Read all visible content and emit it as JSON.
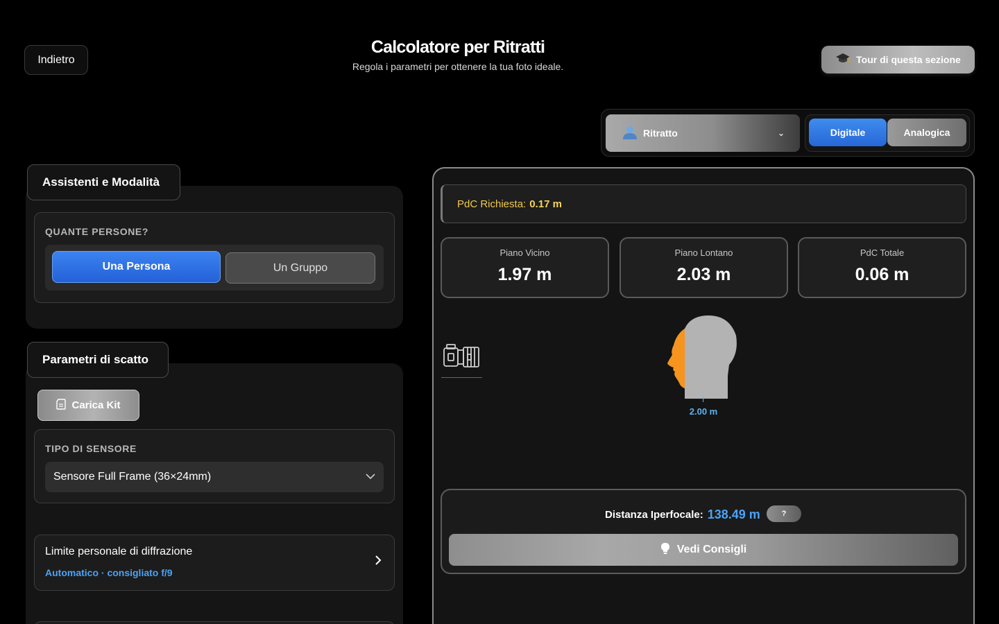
{
  "header": {
    "back_label": "Indietro",
    "title": "Calcolatore per Ritratti",
    "subtitle": "Regola i parametri per ottenere la tua foto ideale.",
    "tour_label": "Tour di questa sezione"
  },
  "mode": {
    "selected": "Ritratto",
    "segments": {
      "digital": "Digitale",
      "analog": "Analogica"
    },
    "active_segment": "Digitale"
  },
  "assistants": {
    "section_label": "Assistenti e Modalità",
    "persons_title": "QUANTE PERSONE?",
    "option_one": "Una Persona",
    "option_group": "Un Gruppo",
    "selected_option": "Una Persona"
  },
  "parameters": {
    "section_label": "Parametri di scatto",
    "kit_label": "Carica Kit",
    "sensor_title": "TIPO DI SENSORE",
    "sensor_value": "Sensore Full Frame (36×24mm)",
    "diffraction_title": "Limite personale di diffrazione",
    "diffraction_sub": "Automatico · consigliato f/9"
  },
  "results": {
    "dof_required_label": "PdC Richiesta:",
    "dof_required_value": "0.17 m",
    "near_label": "Piano Vicino",
    "near_value": "1.97 m",
    "far_label": "Piano Lontano",
    "far_value": "2.03 m",
    "total_label": "PdC Totale",
    "total_value": "0.06 m",
    "subject_distance": "2.00 m",
    "hyperfocal_label": "Distanza Iperfocale:",
    "hyperfocal_value": "138.49 m",
    "help_label": "?",
    "tips_label": "Vedi Consigli"
  },
  "icons": {
    "tour": "graduation-cap-icon",
    "mode": "user-icon",
    "kit": "memory-card-icon",
    "tips": "lightbulb-icon",
    "camera": "camera-icon",
    "subject": "head-silhouette-icon"
  },
  "colors": {
    "accent_blue": "#2f74e4",
    "value_blue": "#4ca3f7",
    "dof_yellow": "#f2c94c",
    "focus_orange": "#f7941d",
    "head_gray": "#b3b3b3"
  }
}
